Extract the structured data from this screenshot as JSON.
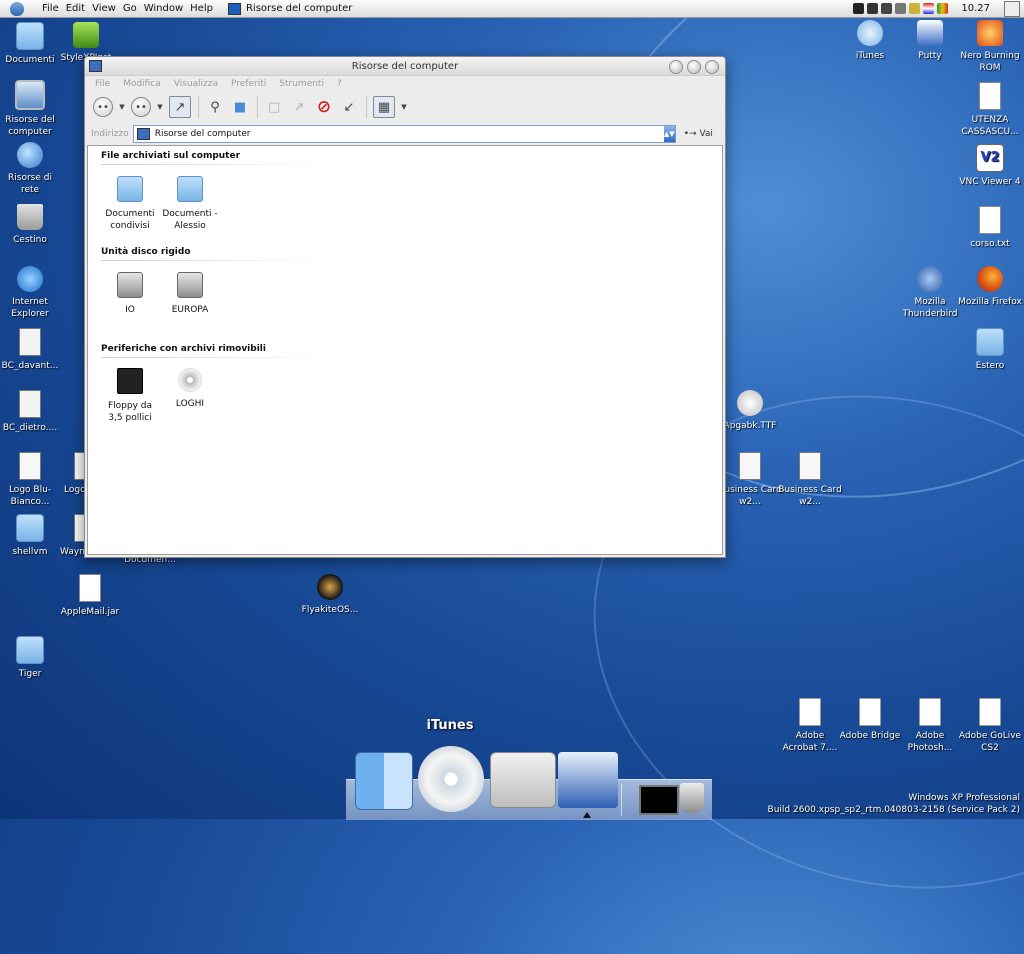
{
  "menubar": {
    "menus": [
      "File",
      "Edit",
      "View",
      "Go",
      "Window",
      "Help"
    ],
    "window_title": "Risorse del computer",
    "clock": "10.27"
  },
  "desktop_left": [
    {
      "label": "Documenti",
      "icon": "folder-icon"
    },
    {
      "label": "StyleXPInst",
      "icon": "stylexp-icon"
    },
    {
      "label": "Risorse del computer",
      "icon": "computer-icon"
    },
    {
      "label": "Risorse di rete",
      "icon": "network-icon"
    },
    {
      "label": "Cestino",
      "icon": "trash-icon"
    },
    {
      "label": "Internet Explorer",
      "icon": "ie-icon"
    },
    {
      "label": "BC_davant...",
      "icon": "jpeg-icon"
    },
    {
      "label": "BC_dietro....",
      "icon": "jpeg-icon"
    },
    {
      "label": "Logo Blu-Bianco...",
      "icon": "illustrator-icon"
    },
    {
      "label": "Logo",
      "icon": "illustrator-icon"
    },
    {
      "label": "shellvm",
      "icon": "folder-icon"
    },
    {
      "label": "Wayn",
      "icon": "illustrator-icon"
    },
    {
      "label": "Documen...",
      "icon": "document-icon"
    },
    {
      "label": "AppleMail.jar",
      "icon": "document-icon"
    },
    {
      "label": "FlyakiteOS...",
      "icon": "flyakite-icon"
    },
    {
      "label": "Tiger",
      "icon": "folder-icon"
    }
  ],
  "desktop_right": [
    {
      "label": "iTunes",
      "icon": "itunes-icon"
    },
    {
      "label": "Putty",
      "icon": "putty-icon"
    },
    {
      "label": "Nero Burning ROM",
      "icon": "nero-icon"
    },
    {
      "label": "UTENZA CASSASCU...",
      "icon": "document-icon"
    },
    {
      "label": "VNC Viewer 4",
      "icon": "vnc-icon"
    },
    {
      "label": "corso.txt",
      "icon": "document-icon"
    },
    {
      "label": "Mozilla Thunderbird",
      "icon": "thunderbird-icon"
    },
    {
      "label": "Mozilla Firefox",
      "icon": "firefox-icon"
    },
    {
      "label": "Estero",
      "icon": "folder-icon"
    },
    {
      "label": "Apgabk.TTF",
      "icon": "font-file-icon"
    },
    {
      "label": "Business Card w2...",
      "icon": "illustrator-icon"
    },
    {
      "label": "Business Card w2...",
      "icon": "illustrator-icon"
    },
    {
      "label": "Adobe Acrobat 7....",
      "icon": "acrobat-icon"
    },
    {
      "label": "Adobe Bridge",
      "icon": "bridge-icon"
    },
    {
      "label": "Adobe Photosh...",
      "icon": "photoshop-icon"
    },
    {
      "label": "Adobe GoLive CS2",
      "icon": "golive-icon"
    }
  ],
  "window": {
    "title": "Risorse del computer",
    "menus": [
      "File",
      "Modifica",
      "Visualizza",
      "Preferiti",
      "Strumenti",
      "?"
    ],
    "address_label": "Indirizzo",
    "address_value": "Risorse del computer",
    "go_label": "Vai",
    "sections": [
      {
        "title": "File archiviati sul computer",
        "items": [
          {
            "label": "Documenti condivisi",
            "icon": "folder-icon"
          },
          {
            "label": "Documenti - Alessio",
            "icon": "folder-icon"
          }
        ]
      },
      {
        "title": "Unità disco rigido",
        "items": [
          {
            "label": "IO",
            "icon": "hard-drive-icon"
          },
          {
            "label": "EUROPA",
            "icon": "hard-drive-icon"
          }
        ]
      },
      {
        "title": "Periferiche con archivi rimovibili",
        "items": [
          {
            "label": "Floppy da 3,5 pollici",
            "icon": "floppy-icon"
          },
          {
            "label": "LOGHI",
            "icon": "cd-icon"
          }
        ]
      }
    ]
  },
  "dock": {
    "hover_label": "iTunes",
    "items": [
      {
        "icon": "finder-icon"
      },
      {
        "icon": "itunes-icon"
      },
      {
        "icon": "system-preferences-icon"
      },
      {
        "icon": "putty-icon"
      },
      {
        "icon": "terminal-icon"
      },
      {
        "icon": "trash-icon"
      }
    ]
  },
  "watermark": {
    "line1": "Windows XP Professional",
    "line2": "Build 2600.xpsp_sp2_rtm.040803-2158 (Service Pack 2)"
  }
}
